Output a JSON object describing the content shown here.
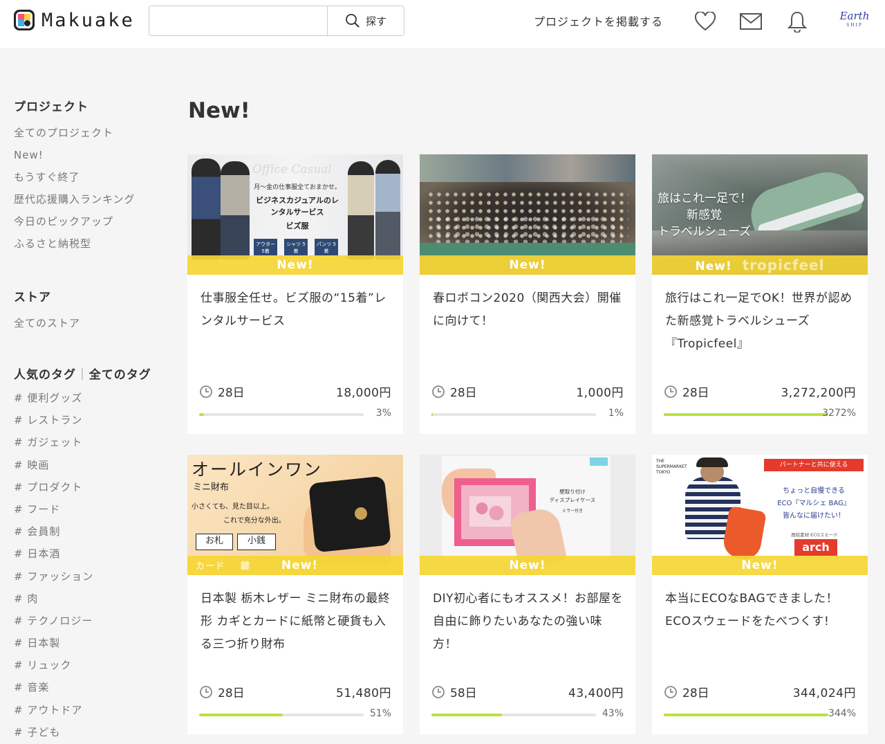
{
  "header": {
    "logo_text": "Makuake",
    "search_placeholder": "",
    "search_button": "探す",
    "post_project": "プロジェクトを掲載する",
    "user_logo_main": "Earth",
    "user_logo_sub": "SHIP"
  },
  "sidebar": {
    "project_heading": "プロジェクト",
    "project_items": [
      "全てのプロジェクト",
      "New!",
      "もうすぐ終了",
      "歴代応援購入ランキング",
      "今日のピックアップ",
      "ふるさと納税型"
    ],
    "store_heading": "ストア",
    "store_items": [
      "全てのストア"
    ],
    "tags_heading": "人気のタグ",
    "tags_all": "全てのタグ",
    "tags": [
      "# 便利グッズ",
      "# レストラン",
      "# ガジェット",
      "# 映画",
      "# プロダクト",
      "# フード",
      "# 会員制",
      "# 日本酒",
      "# ファッション",
      "# 肉",
      "# テクノロジー",
      "# 日本製",
      "# リュック",
      "# 音楽",
      "# アウトドア",
      "# 子ども"
    ]
  },
  "page_title": "New!",
  "cards": [
    {
      "new_label": "New!",
      "title": "仕事服全任せ。ビズ服の“15着”レンタルサービス",
      "days": "28日",
      "amount": "18,000円",
      "percent": "3%",
      "progress": 3,
      "image_text": {
        "banner": "Office Casual",
        "tagline": "月〜金の仕事服全ておまかせ。",
        "headline": "ビジネスカジュアルのレンタルサービス",
        "brand": "ビズ服",
        "chips": [
          "アウター 5着",
          "シャツ 5着",
          "パンツ 5着"
        ]
      }
    },
    {
      "new_label": "New!",
      "title": "春ロボコン2020（関西大会）開催に向けて！",
      "days": "28日",
      "amount": "1,000円",
      "percent": "1%",
      "progress": 1
    },
    {
      "new_label": "New!",
      "title": "旅行はこれ一足でOK！世界が認めた新感覚トラベルシューズ『Tropicfeel』",
      "days": "28日",
      "amount": "3,272,200円",
      "percent": "3272%",
      "progress": 100,
      "image_text": {
        "line1": "旅はこれ一足で！",
        "line2": "新感覚",
        "line3": "トラベルシューズ",
        "brand": "tropicfeel"
      }
    },
    {
      "new_label": "New!",
      "title": "日本製 栃木レザー ミニ財布の最終形 カギとカードに紙幣と硬貨も入る三つ折り財布",
      "days": "28日",
      "amount": "51,480円",
      "percent": "51%",
      "progress": 51,
      "image_text": {
        "headline": "オールインワン",
        "sub": "ミニ財布",
        "line1": "小さくても、見た目以上。",
        "line2": "これで充分な外出。",
        "chips": [
          "お札",
          "小銭",
          "カード",
          "鍵"
        ]
      }
    },
    {
      "new_label": "New!",
      "title": "DIY初心者にもオススメ！お部屋を自由に飾りたいあなたの強い味方！",
      "days": "58日",
      "amount": "43,400円",
      "percent": "43%",
      "progress": 43,
      "image_text": {
        "line1": "壁取り付け",
        "line2": "ディスプレイケース",
        "line3": "ミラー付き"
      }
    },
    {
      "new_label": "New!",
      "title": "本当にECOなBAGできました！ECOスウェードをたべつくす!",
      "days": "28日",
      "amount": "344,024円",
      "percent": "344%",
      "progress": 100,
      "image_text": {
        "store": "THE SUPERMARKET TOKYO",
        "tag": "パートナーと共に使える",
        "line1": "ちょっと自慢できる",
        "line2": "ECO『マルシェ BAG』",
        "line3": "皆んなに届けたい！",
        "line4": "再結素材 ECOスエード",
        "brand": "arch"
      }
    }
  ],
  "colors": {
    "accent_bar": "#b9e23e",
    "new_band": "#f5d634"
  }
}
